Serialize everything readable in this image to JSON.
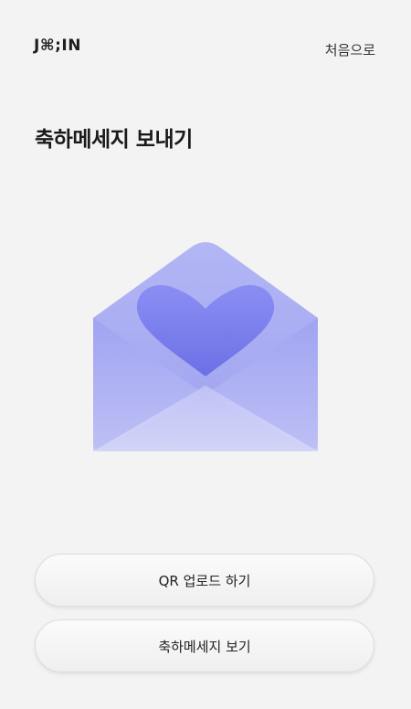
{
  "header": {
    "logo": "J⌘;IN",
    "home_link": "처음으로"
  },
  "page": {
    "title": "축하메세지 보내기"
  },
  "illustration": {
    "icon": "envelope-heart-icon",
    "colors": {
      "heart": "#7b7ff0",
      "envelope": "#a5a9f2",
      "flap": "#c4c6f6"
    }
  },
  "buttons": {
    "upload_label": "QR 업로드 하기",
    "view_label": "축하메세지 보기"
  }
}
